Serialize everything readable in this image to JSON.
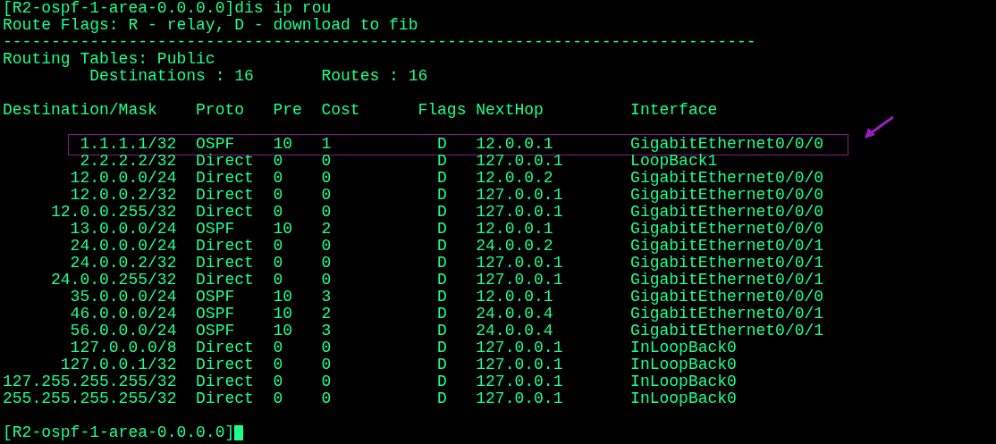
{
  "command_line": {
    "prompt": "[R2-ospf-1-area-0.0.0.0]",
    "command": "dis ip rou"
  },
  "flags_legend": "Route Flags: R - relay, D - download to fib",
  "separator": "------------------------------------------------------------------------------",
  "table_name": "Routing Tables: Public",
  "destinations": "Destinations : 16",
  "routes": "Routes : 16",
  "columns": [
    "Destination/Mask",
    "Proto",
    "Pre",
    "Cost",
    "Flags",
    "NextHop",
    "Interface"
  ],
  "rows": [
    {
      "destination": "1.1.1.1/32",
      "proto": "OSPF",
      "pre": "10",
      "cost": "1",
      "flags": "D",
      "nexthop": "12.0.0.1",
      "interface": "GigabitEthernet0/0/0",
      "highlighted": true
    },
    {
      "destination": "2.2.2.2/32",
      "proto": "Direct",
      "pre": "0",
      "cost": "0",
      "flags": "D",
      "nexthop": "127.0.0.1",
      "interface": "LoopBack1",
      "highlighted": false
    },
    {
      "destination": "12.0.0.0/24",
      "proto": "Direct",
      "pre": "0",
      "cost": "0",
      "flags": "D",
      "nexthop": "12.0.0.2",
      "interface": "GigabitEthernet0/0/0",
      "highlighted": false
    },
    {
      "destination": "12.0.0.2/32",
      "proto": "Direct",
      "pre": "0",
      "cost": "0",
      "flags": "D",
      "nexthop": "127.0.0.1",
      "interface": "GigabitEthernet0/0/0",
      "highlighted": false
    },
    {
      "destination": "12.0.0.255/32",
      "proto": "Direct",
      "pre": "0",
      "cost": "0",
      "flags": "D",
      "nexthop": "127.0.0.1",
      "interface": "GigabitEthernet0/0/0",
      "highlighted": false
    },
    {
      "destination": "13.0.0.0/24",
      "proto": "OSPF",
      "pre": "10",
      "cost": "2",
      "flags": "D",
      "nexthop": "12.0.0.1",
      "interface": "GigabitEthernet0/0/0",
      "highlighted": false
    },
    {
      "destination": "24.0.0.0/24",
      "proto": "Direct",
      "pre": "0",
      "cost": "0",
      "flags": "D",
      "nexthop": "24.0.0.2",
      "interface": "GigabitEthernet0/0/1",
      "highlighted": false
    },
    {
      "destination": "24.0.0.2/32",
      "proto": "Direct",
      "pre": "0",
      "cost": "0",
      "flags": "D",
      "nexthop": "127.0.0.1",
      "interface": "GigabitEthernet0/0/1",
      "highlighted": false
    },
    {
      "destination": "24.0.0.255/32",
      "proto": "Direct",
      "pre": "0",
      "cost": "0",
      "flags": "D",
      "nexthop": "127.0.0.1",
      "interface": "GigabitEthernet0/0/1",
      "highlighted": false
    },
    {
      "destination": "35.0.0.0/24",
      "proto": "OSPF",
      "pre": "10",
      "cost": "3",
      "flags": "D",
      "nexthop": "12.0.0.1",
      "interface": "GigabitEthernet0/0/0",
      "highlighted": false
    },
    {
      "destination": "46.0.0.0/24",
      "proto": "OSPF",
      "pre": "10",
      "cost": "2",
      "flags": "D",
      "nexthop": "24.0.0.4",
      "interface": "GigabitEthernet0/0/1",
      "highlighted": false
    },
    {
      "destination": "56.0.0.0/24",
      "proto": "OSPF",
      "pre": "10",
      "cost": "3",
      "flags": "D",
      "nexthop": "24.0.0.4",
      "interface": "GigabitEthernet0/0/1",
      "highlighted": false
    },
    {
      "destination": "127.0.0.0/8",
      "proto": "Direct",
      "pre": "0",
      "cost": "0",
      "flags": "D",
      "nexthop": "127.0.0.1",
      "interface": "InLoopBack0",
      "highlighted": false
    },
    {
      "destination": "127.0.0.1/32",
      "proto": "Direct",
      "pre": "0",
      "cost": "0",
      "flags": "D",
      "nexthop": "127.0.0.1",
      "interface": "InLoopBack0",
      "highlighted": false
    },
    {
      "destination": "127.255.255.255/32",
      "proto": "Direct",
      "pre": "0",
      "cost": "0",
      "flags": "D",
      "nexthop": "127.0.0.1",
      "interface": "InLoopBack0",
      "highlighted": false
    },
    {
      "destination": "255.255.255.255/32",
      "proto": "Direct",
      "pre": "0",
      "cost": "0",
      "flags": "D",
      "nexthop": "127.0.0.1",
      "interface": "InLoopBack0",
      "highlighted": false
    }
  ],
  "final_prompt": "[R2-ospf-1-area-0.0.0.0]"
}
